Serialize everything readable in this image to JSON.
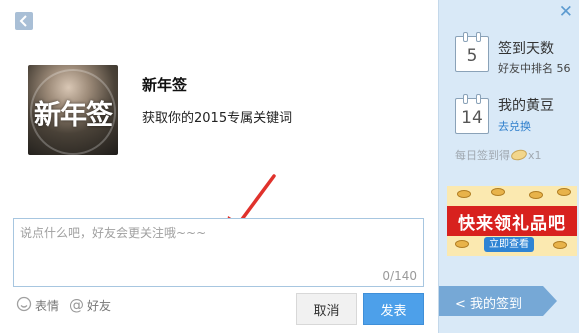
{
  "left": {
    "app_title": "新年签",
    "app_thumb_text": "新年签",
    "app_desc": "获取你的2015专属关键词",
    "comment": {
      "placeholder": "说点什么吧，好友会更关注哦~~~",
      "value": "",
      "char_count": "0/140"
    },
    "tools": {
      "emoji_label": "表情",
      "mention_label": "好友"
    },
    "buttons": {
      "cancel": "取消",
      "send": "发表"
    }
  },
  "right": {
    "sign_days": {
      "icon_number": "5",
      "title": "签到天数",
      "subtitle": "好友中排名 56"
    },
    "beans": {
      "icon_number": "14",
      "title": "我的黄豆",
      "link": "去兑换"
    },
    "bonus": {
      "prefix": "每日签到得",
      "suffix": "x1"
    },
    "ad": {
      "headline": "快来领礼品吧",
      "button": "立即查看"
    },
    "my_signin_label": "< 我的签到"
  },
  "colors": {
    "accent_blue": "#4da0ea",
    "panel_blue": "#d9e9f7",
    "arrow_red": "#e0322c",
    "ad_red": "#d8211e"
  },
  "icons": {
    "back": "chevron-left-icon",
    "close": "close-icon",
    "emoji": "smile-icon",
    "mention": "at-icon",
    "calendar": "calendar-icon",
    "bean": "bean-icon"
  }
}
